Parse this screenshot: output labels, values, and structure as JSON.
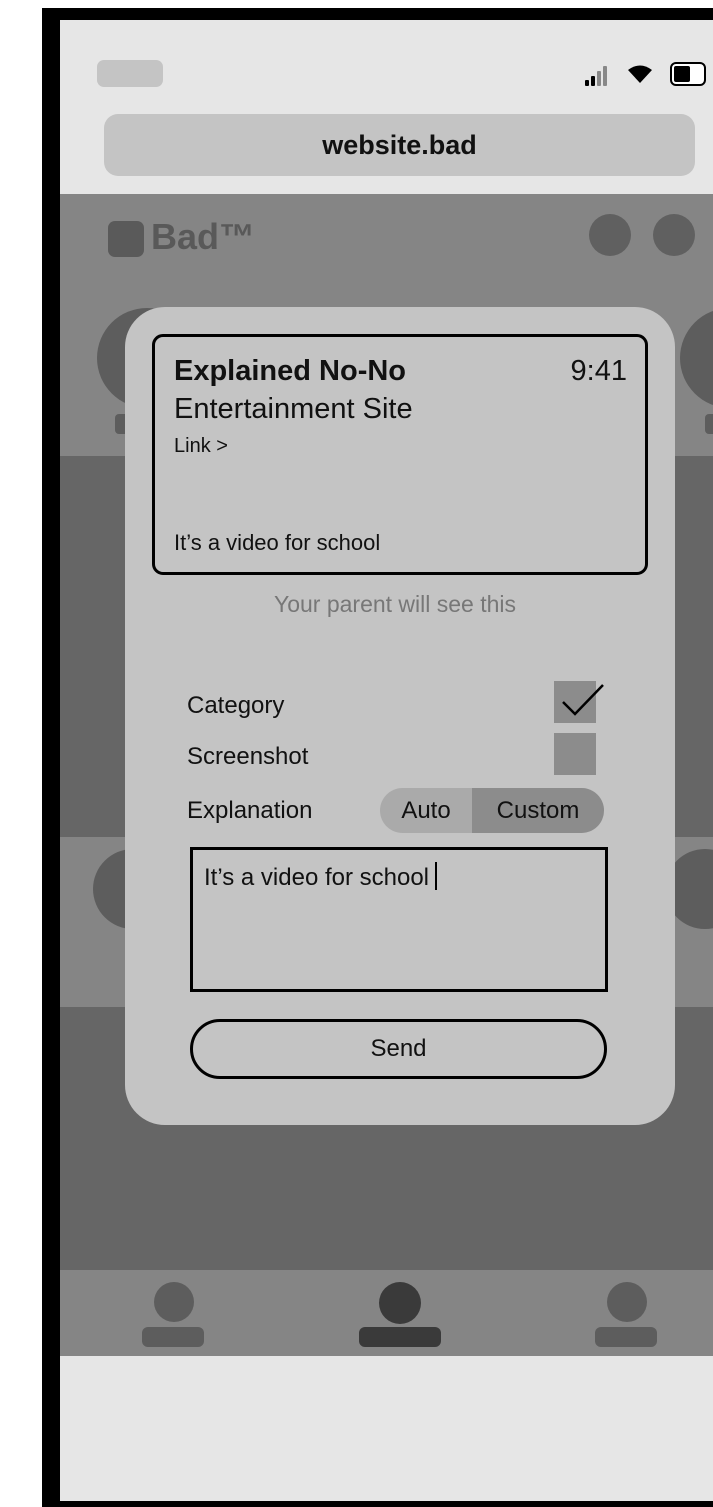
{
  "browser": {
    "url": "website.bad"
  },
  "site": {
    "logo_text": "Bad™"
  },
  "notification": {
    "title": "Explained No-No",
    "time": "9:41",
    "subtitle": "Entertainment Site",
    "link": "Link >",
    "message": "It’s a video for school"
  },
  "modal": {
    "parent_note": "Your parent will see this",
    "rows": {
      "category_label": "Category",
      "category_checked": true,
      "screenshot_label": "Screenshot",
      "screenshot_checked": false,
      "explanation_label": "Explanation"
    },
    "explanation_mode": {
      "options": [
        "Auto",
        "Custom"
      ],
      "selected": "Custom"
    },
    "explanation_text": "It’s a video for school",
    "send_label": "Send"
  },
  "colors": {
    "modal_bg": "#c4c4c4",
    "overlay": "#666666",
    "selected_segment": "#8c8c8c"
  }
}
